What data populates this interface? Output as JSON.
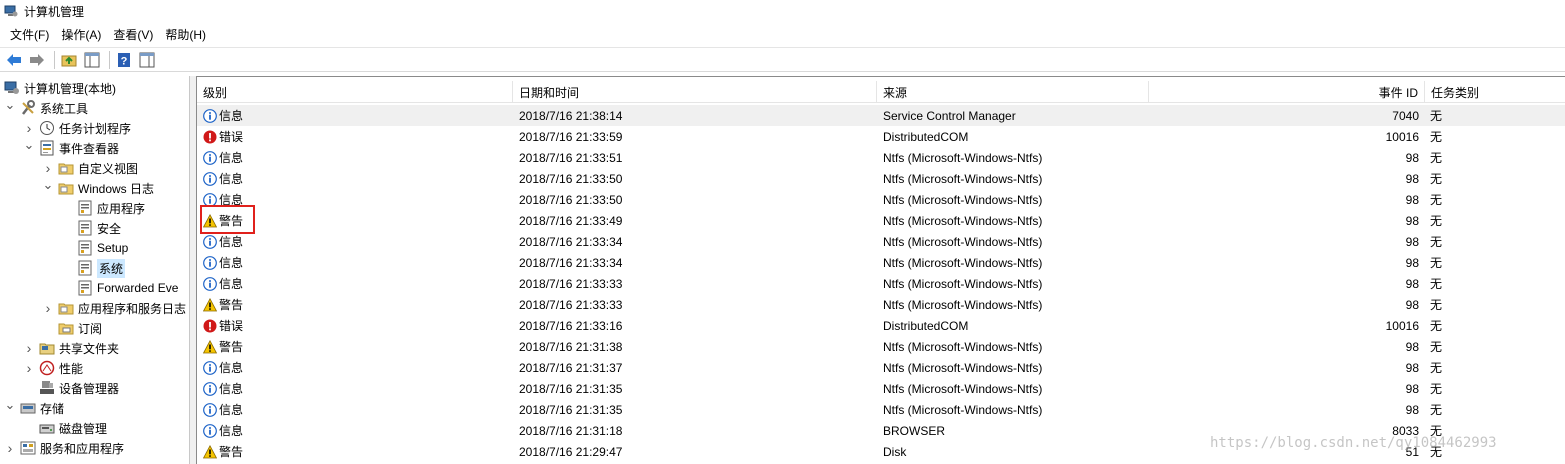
{
  "window": {
    "title": "计算机管理"
  },
  "menu": [
    "文件(F)",
    "操作(A)",
    "查看(V)",
    "帮助(H)"
  ],
  "toolbar": {
    "buttons": [
      "back-icon",
      "forward-icon",
      "up-folder-icon",
      "show-hide-tree-icon",
      "help-icon",
      "show-action-pane-icon"
    ]
  },
  "tree": {
    "items": [
      {
        "label": "计算机管理(本地)",
        "icon": "computer-management-icon",
        "chevron": ""
      },
      {
        "label": "系统工具",
        "icon": "system-tools-icon",
        "chevron": "expanded"
      },
      {
        "label": "任务计划程序",
        "icon": "clock-icon",
        "chevron": "collapsed"
      },
      {
        "label": "事件查看器",
        "icon": "event-viewer-icon",
        "chevron": "expanded"
      },
      {
        "label": "自定义视图",
        "icon": "folder-icon",
        "chevron": "collapsed"
      },
      {
        "label": "Windows 日志",
        "icon": "folder-icon",
        "chevron": "expanded"
      },
      {
        "label": "应用程序",
        "icon": "log-icon",
        "chevron": ""
      },
      {
        "label": "安全",
        "icon": "log-icon",
        "chevron": ""
      },
      {
        "label": "Setup",
        "icon": "log-icon",
        "chevron": ""
      },
      {
        "label": "系统",
        "icon": "log-icon",
        "chevron": "",
        "selected": true
      },
      {
        "label": "Forwarded Eve",
        "icon": "log-icon",
        "chevron": ""
      },
      {
        "label": "应用程序和服务日志",
        "icon": "folder-icon",
        "chevron": "collapsed"
      },
      {
        "label": "订阅",
        "icon": "subscription-icon",
        "chevron": ""
      },
      {
        "label": "共享文件夹",
        "icon": "shared-folder-icon",
        "chevron": "collapsed"
      },
      {
        "label": "性能",
        "icon": "performance-icon",
        "chevron": "collapsed"
      },
      {
        "label": "设备管理器",
        "icon": "device-manager-icon",
        "chevron": ""
      },
      {
        "label": "存储",
        "icon": "storage-icon",
        "chevron": "expanded"
      },
      {
        "label": "磁盘管理",
        "icon": "disk-management-icon",
        "chevron": ""
      },
      {
        "label": "服务和应用程序",
        "icon": "services-icon",
        "chevron": "collapsed"
      }
    ]
  },
  "list": {
    "columns": [
      "级别",
      "日期和时间",
      "来源",
      "事件 ID",
      "任务类别"
    ],
    "rows": [
      {
        "level": "信息",
        "type": "info",
        "date": "2018/7/16 21:38:14",
        "source": "Service Control Manager",
        "id": "7040",
        "category": "无"
      },
      {
        "level": "错误",
        "type": "error",
        "date": "2018/7/16 21:33:59",
        "source": "DistributedCOM",
        "id": "10016",
        "category": "无"
      },
      {
        "level": "信息",
        "type": "info",
        "date": "2018/7/16 21:33:51",
        "source": "Ntfs (Microsoft-Windows-Ntfs)",
        "id": "98",
        "category": "无"
      },
      {
        "level": "信息",
        "type": "info",
        "date": "2018/7/16 21:33:50",
        "source": "Ntfs (Microsoft-Windows-Ntfs)",
        "id": "98",
        "category": "无"
      },
      {
        "level": "信息",
        "type": "info",
        "date": "2018/7/16 21:33:50",
        "source": "Ntfs (Microsoft-Windows-Ntfs)",
        "id": "98",
        "category": "无"
      },
      {
        "level": "警告",
        "type": "warning",
        "date": "2018/7/16 21:33:49",
        "source": "Ntfs (Microsoft-Windows-Ntfs)",
        "id": "98",
        "category": "无"
      },
      {
        "level": "信息",
        "type": "info",
        "date": "2018/7/16 21:33:34",
        "source": "Ntfs (Microsoft-Windows-Ntfs)",
        "id": "98",
        "category": "无"
      },
      {
        "level": "信息",
        "type": "info",
        "date": "2018/7/16 21:33:34",
        "source": "Ntfs (Microsoft-Windows-Ntfs)",
        "id": "98",
        "category": "无"
      },
      {
        "level": "信息",
        "type": "info",
        "date": "2018/7/16 21:33:33",
        "source": "Ntfs (Microsoft-Windows-Ntfs)",
        "id": "98",
        "category": "无"
      },
      {
        "level": "警告",
        "type": "warning",
        "date": "2018/7/16 21:33:33",
        "source": "Ntfs (Microsoft-Windows-Ntfs)",
        "id": "98",
        "category": "无"
      },
      {
        "level": "错误",
        "type": "error",
        "date": "2018/7/16 21:33:16",
        "source": "DistributedCOM",
        "id": "10016",
        "category": "无"
      },
      {
        "level": "警告",
        "type": "warning",
        "date": "2018/7/16 21:31:38",
        "source": "Ntfs (Microsoft-Windows-Ntfs)",
        "id": "98",
        "category": "无"
      },
      {
        "level": "信息",
        "type": "info",
        "date": "2018/7/16 21:31:37",
        "source": "Ntfs (Microsoft-Windows-Ntfs)",
        "id": "98",
        "category": "无"
      },
      {
        "level": "信息",
        "type": "info",
        "date": "2018/7/16 21:31:35",
        "source": "Ntfs (Microsoft-Windows-Ntfs)",
        "id": "98",
        "category": "无"
      },
      {
        "level": "信息",
        "type": "info",
        "date": "2018/7/16 21:31:35",
        "source": "Ntfs (Microsoft-Windows-Ntfs)",
        "id": "98",
        "category": "无"
      },
      {
        "level": "信息",
        "type": "info",
        "date": "2018/7/16 21:31:18",
        "source": "BROWSER",
        "id": "8033",
        "category": "无"
      },
      {
        "level": "警告",
        "type": "warning",
        "date": "2018/7/16 21:29:47",
        "source": "Disk",
        "id": "51",
        "category": "无"
      }
    ]
  },
  "watermark": "https://blog.csdn.net/qy1084462993",
  "colors": {
    "info": "#1e64c8",
    "error": "#d01818",
    "warning": "#f5c400",
    "highlight": "#e0211c",
    "selection": "#cce8ff"
  }
}
